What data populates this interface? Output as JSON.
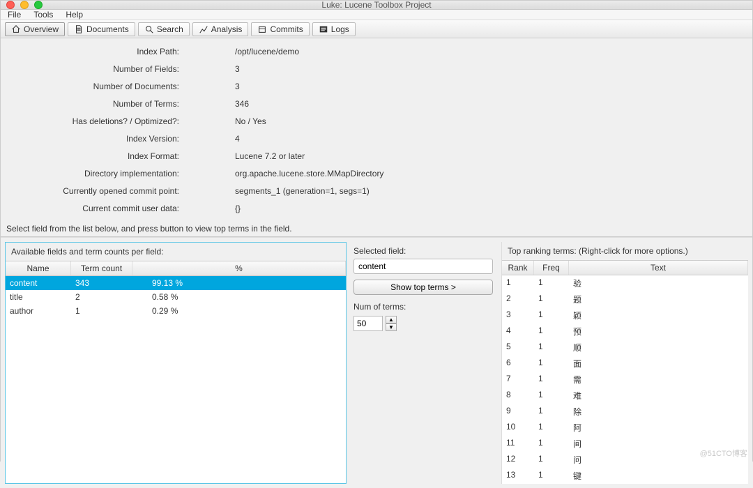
{
  "window": {
    "title": "Luke: Lucene Toolbox Project"
  },
  "menubar": [
    "File",
    "Tools",
    "Help"
  ],
  "tabs": [
    {
      "label": "Overview",
      "active": true
    },
    {
      "label": "Documents"
    },
    {
      "label": "Search"
    },
    {
      "label": "Analysis"
    },
    {
      "label": "Commits"
    },
    {
      "label": "Logs"
    }
  ],
  "info": [
    {
      "label": "Index Path:",
      "value": "/opt/lucene/demo"
    },
    {
      "label": "Number of Fields:",
      "value": "3"
    },
    {
      "label": "Number of Documents:",
      "value": "3"
    },
    {
      "label": "Number of Terms:",
      "value": "346"
    },
    {
      "label": "Has deletions? / Optimized?:",
      "value": "No / Yes"
    },
    {
      "label": "Index Version:",
      "value": "4"
    },
    {
      "label": "Index Format:",
      "value": "Lucene 7.2 or later"
    },
    {
      "label": "Directory implementation:",
      "value": "org.apache.lucene.store.MMapDirectory"
    },
    {
      "label": "Currently opened commit point:",
      "value": "segments_1 (generation=1, segs=1)"
    },
    {
      "label": "Current commit user data:",
      "value": "{}"
    }
  ],
  "instruction": "Select field from the list below, and press button to view top terms in the field.",
  "fields_panel": {
    "title": "Available fields and term counts per field:",
    "headers": {
      "name": "Name",
      "term": "Term count",
      "pct": "%"
    },
    "rows": [
      {
        "name": "content",
        "term": "343",
        "pct": "99.13 %",
        "sel": true
      },
      {
        "name": "title",
        "term": "2",
        "pct": "0.58 %"
      },
      {
        "name": "author",
        "term": "1",
        "pct": "0.29 %"
      }
    ]
  },
  "mid": {
    "selected_label": "Selected field:",
    "selected_value": "content",
    "button": "Show top terms >",
    "num_label": "Num of terms:",
    "num_value": "50"
  },
  "terms_panel": {
    "title": "Top ranking terms: (Right-click for more options.)",
    "headers": {
      "rank": "Rank",
      "freq": "Freq",
      "text": "Text"
    },
    "rows": [
      {
        "rank": "1",
        "freq": "1",
        "text": "验"
      },
      {
        "rank": "2",
        "freq": "1",
        "text": "题"
      },
      {
        "rank": "3",
        "freq": "1",
        "text": "颖"
      },
      {
        "rank": "4",
        "freq": "1",
        "text": "预"
      },
      {
        "rank": "5",
        "freq": "1",
        "text": "顺"
      },
      {
        "rank": "6",
        "freq": "1",
        "text": "面"
      },
      {
        "rank": "7",
        "freq": "1",
        "text": "需"
      },
      {
        "rank": "8",
        "freq": "1",
        "text": "难"
      },
      {
        "rank": "9",
        "freq": "1",
        "text": "除"
      },
      {
        "rank": "10",
        "freq": "1",
        "text": "阿"
      },
      {
        "rank": "11",
        "freq": "1",
        "text": "间"
      },
      {
        "rank": "12",
        "freq": "1",
        "text": "问"
      },
      {
        "rank": "13",
        "freq": "1",
        "text": "键"
      }
    ]
  },
  "watermark": "@51CTO博客"
}
